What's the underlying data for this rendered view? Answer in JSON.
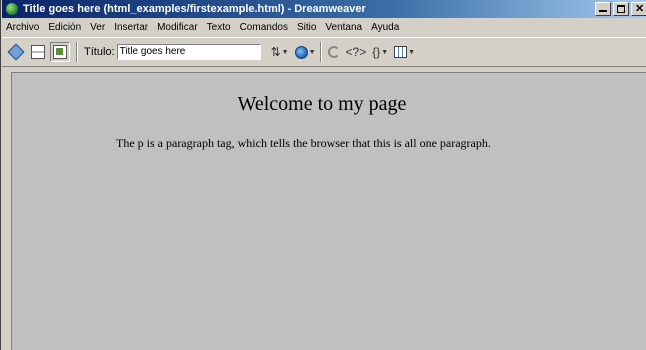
{
  "window": {
    "title": "Title goes here (html_examples/firstexample.html) - Dreamweaver",
    "controls": {
      "minimize": "_",
      "maximize": "□",
      "close": "✕"
    }
  },
  "menubar": {
    "items": [
      {
        "label": "Archivo"
      },
      {
        "label": "Edición"
      },
      {
        "label": "Ver"
      },
      {
        "label": "Insertar"
      },
      {
        "label": "Modificar"
      },
      {
        "label": "Texto"
      },
      {
        "label": "Comandos"
      },
      {
        "label": "Sitio"
      },
      {
        "label": "Ventana"
      },
      {
        "label": "Ayuda"
      }
    ]
  },
  "toolbar": {
    "view_buttons": [
      {
        "icon": "code-view-icon"
      },
      {
        "icon": "split-view-icon"
      },
      {
        "icon": "design-view-icon"
      }
    ],
    "title_label": "Título:",
    "title_value": "Title goes here",
    "icons": [
      "file-management-icon",
      "preview-browser-icon",
      "refresh-icon",
      "reference-icon",
      "code-navigation-icon",
      "view-options-icon"
    ]
  },
  "document": {
    "heading": "Welcome to my page",
    "paragraph": "The p is a paragraph tag, which tells the browser that this is all one paragraph."
  }
}
